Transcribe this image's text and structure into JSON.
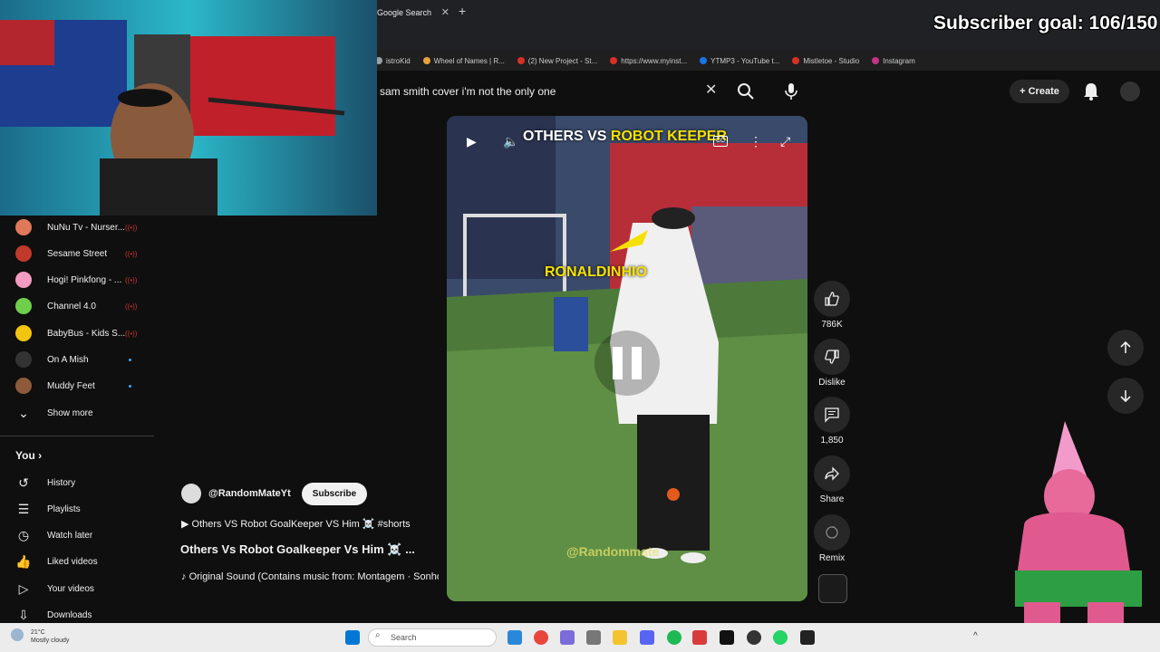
{
  "browser": {
    "tab_title": "Google Search",
    "bookmarks": [
      {
        "label": "istroKid",
        "color": "#9aa0a6"
      },
      {
        "label": "Wheel of Names | R...",
        "color": "#e8a33d"
      },
      {
        "label": "(2) New Project - St...",
        "color": "#d93025"
      },
      {
        "label": "https://www.myinst...",
        "color": "#d93025"
      },
      {
        "label": "YTMP3 - YouTube t...",
        "color": "#1a73e8"
      },
      {
        "label": "Mistletoe - Studio",
        "color": "#d93025"
      },
      {
        "label": "Instagram",
        "color": "#c13584"
      }
    ]
  },
  "header": {
    "search_value": "sam smith cover i'm not the only one",
    "create_label": "Create"
  },
  "subscriber_goal": "Subscriber goal: 106/150",
  "sidebar": {
    "subscriptions": [
      {
        "label": "NuNu Tv - Nurser...",
        "marker": "live",
        "color": "#e0785a"
      },
      {
        "label": "Sesame Street",
        "marker": "live",
        "color": "#c0392b"
      },
      {
        "label": "Hogi! Pinkfong - ...",
        "marker": "live",
        "color": "#f39cc1"
      },
      {
        "label": "Channel 4.0",
        "marker": "live",
        "color": "#6fcf4a"
      },
      {
        "label": "BabyBus - Kids S...",
        "marker": "live",
        "color": "#f1c40f"
      },
      {
        "label": "On A Mish",
        "marker": "new",
        "color": "#333333"
      },
      {
        "label": "Muddy Feet",
        "marker": "new",
        "color": "#8e5a3a"
      }
    ],
    "show_more_label": "Show more",
    "you_label": "You",
    "you_items": [
      {
        "label": "History",
        "icon": "history-icon"
      },
      {
        "label": "Playlists",
        "icon": "playlists-icon"
      },
      {
        "label": "Watch later",
        "icon": "watch-later-icon"
      },
      {
        "label": "Liked videos",
        "icon": "liked-videos-icon"
      },
      {
        "label": "Your videos",
        "icon": "your-videos-icon"
      },
      {
        "label": "Downloads",
        "icon": "downloads-icon"
      }
    ]
  },
  "player": {
    "title_white": "OTHERS VS ",
    "title_yellow": "ROBOT KEEPER",
    "overlay_label": "RONALDINHIO",
    "watermark": "@Randommate",
    "cc_label": "CC"
  },
  "actions": {
    "likes": "786K",
    "dislike_label": "Dislike",
    "comments": "1,850",
    "share_label": "Share",
    "remix_label": "Remix"
  },
  "meta": {
    "channel_name": "@RandomMateYt",
    "subscribe_label": "Subscribe",
    "playlist_line": "Others VS Robot GoalKeeper VS Him ☠️ #shorts",
    "video_title": "Others Vs Robot Goalkeeper Vs Him ☠️ ...",
    "sound_line": "Original Sound (Contains music from: Montagem · Sonho)"
  },
  "taskbar": {
    "weather_temp": "21°C",
    "weather_desc": "Mostly cloudy",
    "search_placeholder": "Search"
  }
}
